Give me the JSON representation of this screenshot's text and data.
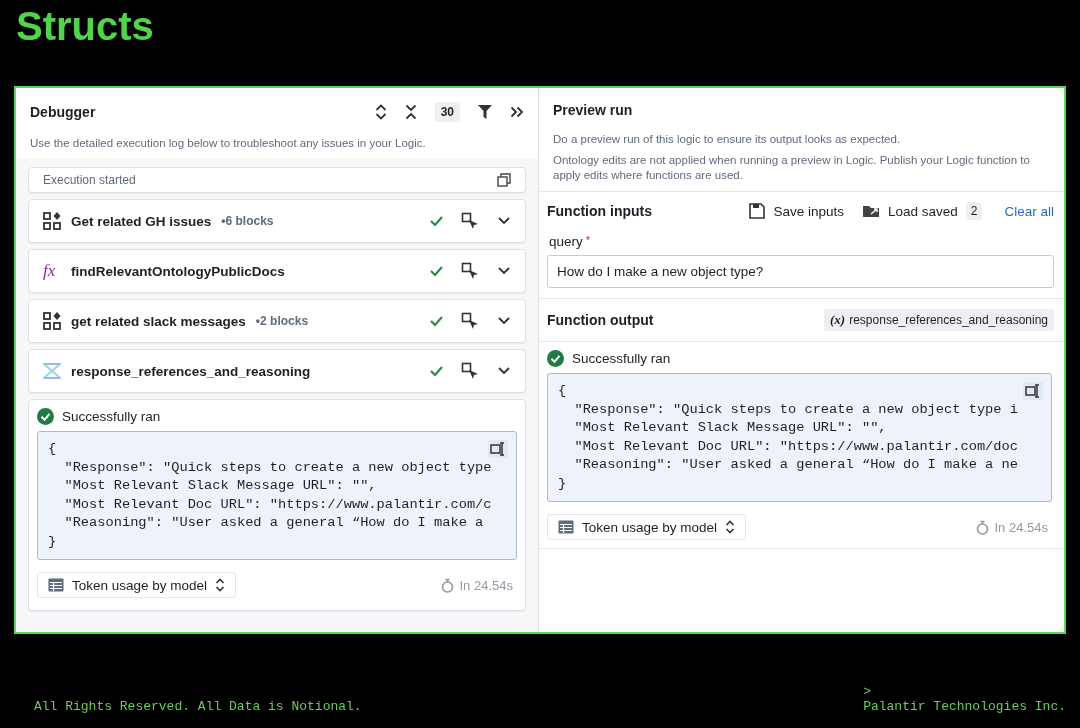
{
  "slide_title": "Structs",
  "debugger": {
    "title": "Debugger",
    "count": "30",
    "description": "Use the detailed execution log below to troubleshoot any issues in your Logic.",
    "execution_started": "Execution started",
    "blocks": [
      {
        "kind": "group",
        "name": "Get related GH issues",
        "meta": "•6 blocks"
      },
      {
        "kind": "function",
        "icon_text": "fx",
        "name": "findRelevantOntologyPublicDocs"
      },
      {
        "kind": "group",
        "name": "get related slack messages",
        "meta": "•2 blocks"
      },
      {
        "kind": "struct",
        "name": "response_references_and_reasoning"
      }
    ],
    "result": {
      "status": "Successfully ran",
      "code_lines": [
        "{",
        "  \"Response\": \"Quick steps to create a new object type",
        "  \"Most Relevant Slack Message URL\": \"\",",
        "  \"Most Relevant Doc URL\": \"https://www.palantir.com/c",
        "  \"Reasoning\": \"User asked a general “How do I make a",
        "}"
      ],
      "token_usage": "Token usage by model",
      "duration": "In 24.54s"
    }
  },
  "preview": {
    "title": "Preview run",
    "description": "Do a preview run of this logic to ensure its output looks as expected.",
    "note": "Ontology edits are not applied when running a preview in Logic. Publish your Logic function to apply edits where functions are used.",
    "inputs": {
      "title": "Function inputs",
      "save": "Save inputs",
      "load": "Load saved",
      "saved_count": "2",
      "clear": "Clear all",
      "field_label": "query",
      "required": "*",
      "field_value": "How do I make a new object type?"
    },
    "output": {
      "title": "Function output",
      "badge_icon": "(x)",
      "badge": "response_references_and_reasoning",
      "result": {
        "status": "Successfully ran",
        "code_lines": [
          "{",
          "  \"Response\": \"Quick steps to create a new object type i",
          "  \"Most Relevant Slack Message URL\": \"\",",
          "  \"Most Relevant Doc URL\": \"https://www.palantir.com/doc",
          "  \"Reasoning\": \"User asked a general “How do I make a ne",
          "}"
        ],
        "token_usage": "Token usage by model",
        "duration": "In 24.54s"
      }
    }
  },
  "footer": {
    "copyright": "All Rights Reserved. All Data is Notional.",
    "prompt": ">",
    "company": "Palantir Technologies Inc."
  }
}
